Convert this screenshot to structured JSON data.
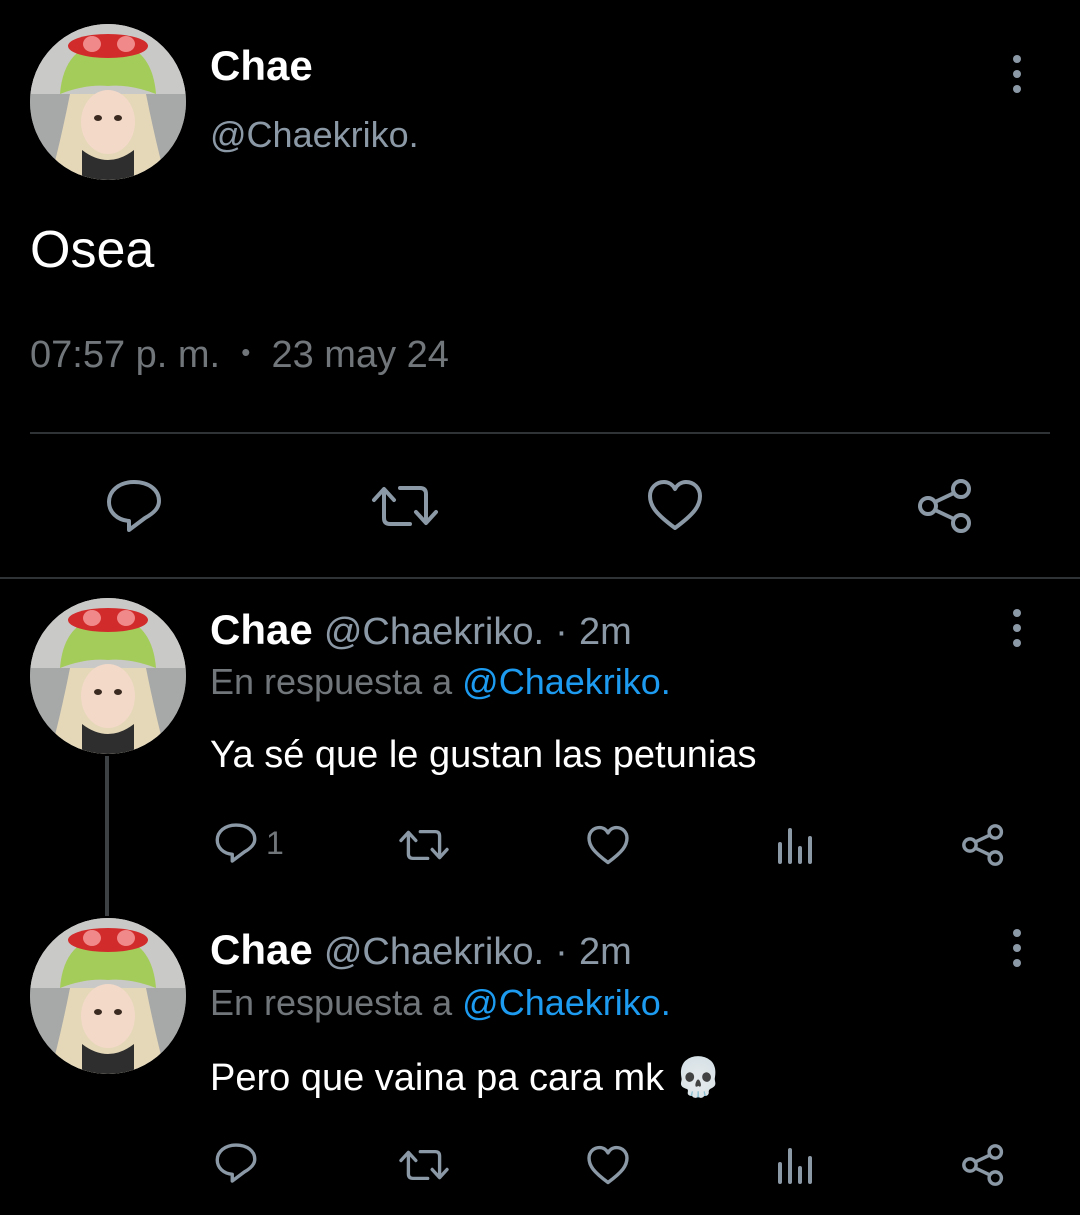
{
  "main_tweet": {
    "name": "Chae",
    "handle": "@Chaekriko.",
    "text": "Osea",
    "time": "07:57 p. m.",
    "dot": "•",
    "date": "23 may 24",
    "actions": [
      "reply-icon",
      "retweet-icon",
      "like-icon",
      "share-icon"
    ]
  },
  "replies": [
    {
      "name": "Chae",
      "handle": "@Chaekriko.",
      "separator": "·",
      "age": "2m",
      "reply_prefix": "En respuesta a",
      "reply_to": "@Chaekriko.",
      "text": "Ya sé que le gustan las petunias",
      "reply_count": "1"
    },
    {
      "name": "Chae",
      "handle": "@Chaekriko.",
      "separator": "·",
      "age": "2m",
      "reply_prefix": "En respuesta a",
      "reply_to": "@Chaekriko.",
      "text": "Pero que vaina pa cara mk 💀",
      "reply_count": ""
    }
  ],
  "colors": {
    "background": "#000000",
    "text": "#ffffff",
    "secondary": "#71767b",
    "mention": "#1d9bf0",
    "divider": "#2f3336"
  }
}
